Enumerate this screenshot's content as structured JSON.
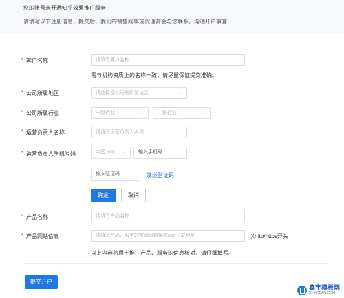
{
  "notice": {
    "line1": "您的账号未开通知乎效果推广服务",
    "line2": "请填写以下注册信息，提交后，我们的销售同事或代理商会与您联系，沟通开户事宜"
  },
  "form": {
    "customer_name": {
      "label": "客户名称",
      "placeholder": "请填写客户名称",
      "hint": "需与机构资质上的名称一致，请尽量保证提交准确。"
    },
    "region": {
      "label": "公司所属地区",
      "placeholder": "请选择您公司的所属地区"
    },
    "industry": {
      "label": "公司所属行业",
      "level1_placeholder": "一级行业",
      "level2_placeholder": "二级行业"
    },
    "contact_name": {
      "label": "运营负责人名称",
      "placeholder": "请填写运营负责人名称"
    },
    "contact_phone": {
      "label": "运营负责人手机号码",
      "country_code": "中国 +86",
      "placeholder": "输入手机号",
      "code_placeholder": "输入验证码",
      "send_code": "发送验证码",
      "confirm": "确定",
      "cancel": "取消"
    },
    "product_name": {
      "label": "产品名称",
      "placeholder": "请填写产品名称"
    },
    "product_url": {
      "label": "产品网站信息",
      "placeholder": "请填写产品、服务的官网页链接或app下载地址",
      "suffix": "以http/https开头",
      "hint": "以上内容将用于推广产品、服务的信息核对，请仔细填写。"
    },
    "submit": "提交开户"
  },
  "watermark": {
    "main": "鑫宇模板网",
    "sub": "XYMOBAN.COM"
  },
  "colors": {
    "primary": "#1e78e6",
    "link": "#2b6fd6",
    "required": "#e03b3b"
  }
}
